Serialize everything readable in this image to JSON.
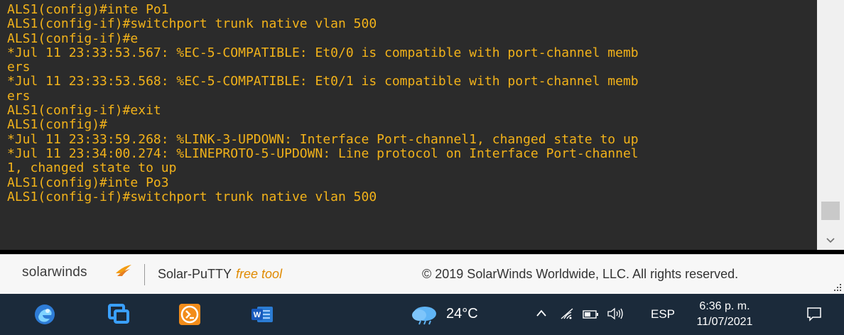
{
  "terminal": {
    "lines": [
      "ALS1(config)#inte Po1",
      "ALS1(config-if)#switchport trunk native vlan 500",
      "ALS1(config-if)#e",
      "*Jul 11 23:33:53.567: %EC-5-COMPATIBLE: Et0/0 is compatible with port-channel memb",
      "ers",
      "*Jul 11 23:33:53.568: %EC-5-COMPATIBLE: Et0/1 is compatible with port-channel memb",
      "ers",
      "ALS1(config-if)#exit",
      "ALS1(config)#",
      "*Jul 11 23:33:59.268: %LINK-3-UPDOWN: Interface Port-channel1, changed state to up",
      "*Jul 11 23:34:00.274: %LINEPROTO-5-UPDOWN: Line protocol on Interface Port-channel",
      "1, changed state to up",
      "ALS1(config)#inte Po3",
      "ALS1(config-if)#switchport trunk native vlan 500"
    ],
    "text_color": "#f2b21a",
    "background": "#2b2b2b"
  },
  "statusbar": {
    "brand": "solarwinds",
    "app_name": "Solar-PuTTY",
    "app_tag": "free tool",
    "copyright": "© 2019 SolarWinds Worldwide, LLC. All rights reserved."
  },
  "taskbar": {
    "apps": [
      "edge-beta-icon",
      "remote-desktop-icon",
      "solar-putty-icon",
      "word-icon"
    ],
    "weather": {
      "icon": "cloud-rain-icon",
      "temp": "24°C"
    },
    "tray_icons": [
      "chevron-up-icon",
      "wifi-icon",
      "battery-icon",
      "volume-icon"
    ],
    "language": "ESP",
    "time": "6:36 p. m.",
    "date": "11/07/2021",
    "notification_icon": "notification-icon"
  }
}
